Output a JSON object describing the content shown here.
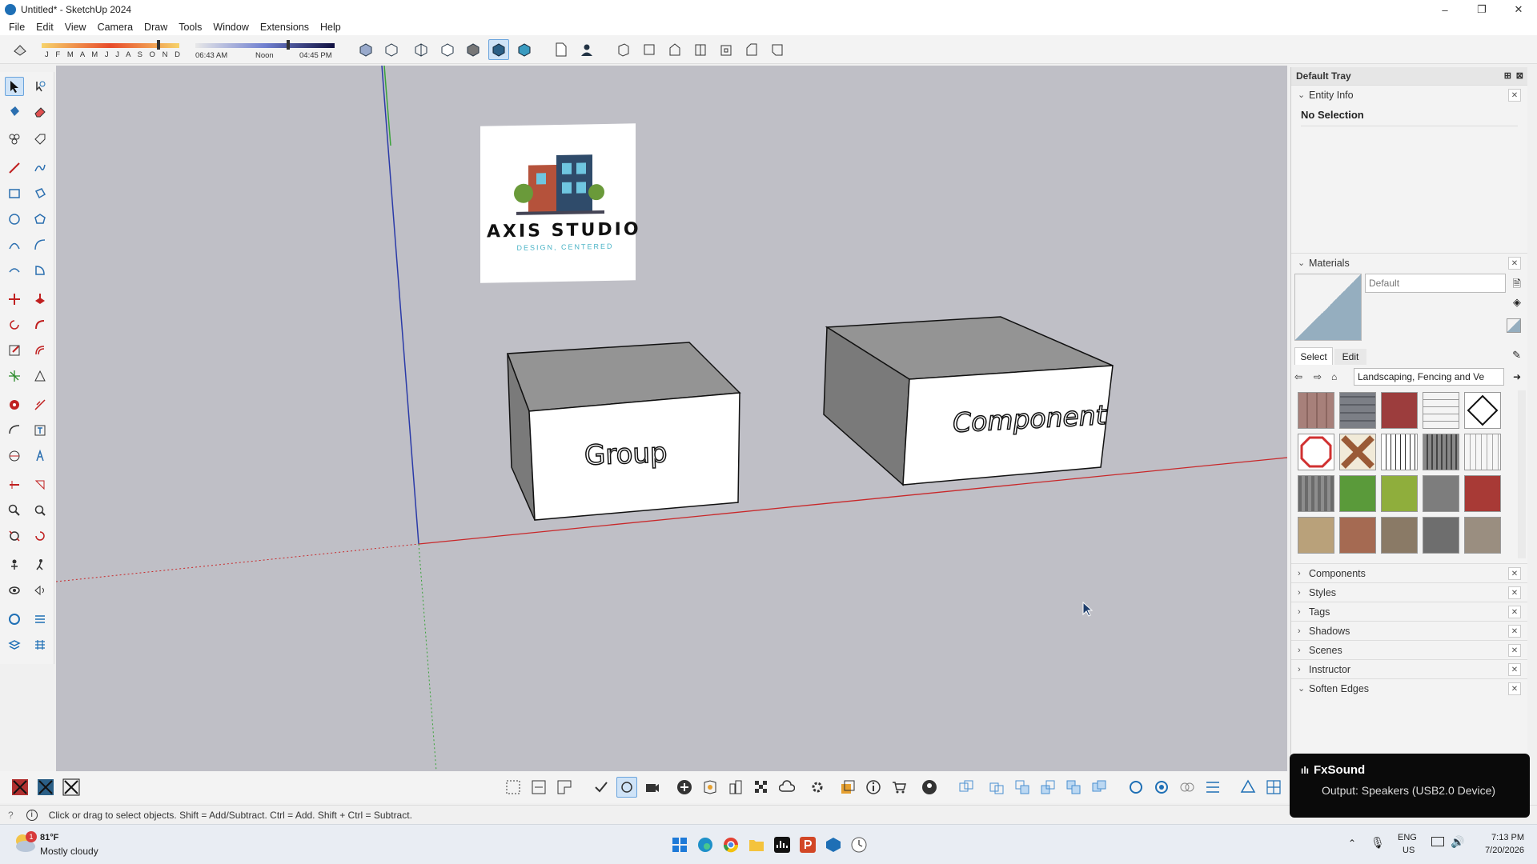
{
  "window": {
    "title": "Untitled* - SketchUp 2024",
    "controls": [
      "–",
      "❐",
      "✕"
    ]
  },
  "menu": [
    "File",
    "Edit",
    "View",
    "Camera",
    "Draw",
    "Tools",
    "Window",
    "Extensions",
    "Help"
  ],
  "toolbar": {
    "months": "J F M A M J J A S O N D",
    "time_start": "06:43 AM",
    "time_noon": "Noon",
    "time_end": "04:45 PM"
  },
  "scene": {
    "logo_title": "AXIS STUDIO",
    "logo_tagline": "DESIGN, CENTERED",
    "group_label": "Group",
    "component_label": "Component"
  },
  "tray": {
    "title": "Default Tray",
    "entity_info": {
      "title": "Entity Info",
      "status": "No Selection"
    },
    "materials": {
      "title": "Materials",
      "name_placeholder": "Default",
      "tabs": [
        "Select",
        "Edit"
      ],
      "library": "Landscaping, Fencing and Ve"
    },
    "panels": [
      "Components",
      "Styles",
      "Tags",
      "Shadows",
      "Scenes",
      "Instructor",
      "Soften Edges"
    ]
  },
  "status": {
    "hint": "Click or drag to select objects. Shift = Add/Subtract. Ctrl = Add. Shift + Ctrl = Subtract."
  },
  "taskbar": {
    "weather_temp": "81°F",
    "weather_desc": "Mostly cloudy",
    "badge": "1",
    "lang": "ENG",
    "region": "US",
    "time": "7:13 PM",
    "date": "7/20/2026"
  },
  "fxsound": {
    "title": "FxSound",
    "output": "Output: Speakers (USB2.0 Device)"
  },
  "colors": {
    "x_axis": "#c8282a",
    "y_axis": "#3aa33a",
    "z_axis": "#2a3aa8",
    "viewport_bg": "#bfbfc6",
    "accent": "#1e6fb5"
  }
}
